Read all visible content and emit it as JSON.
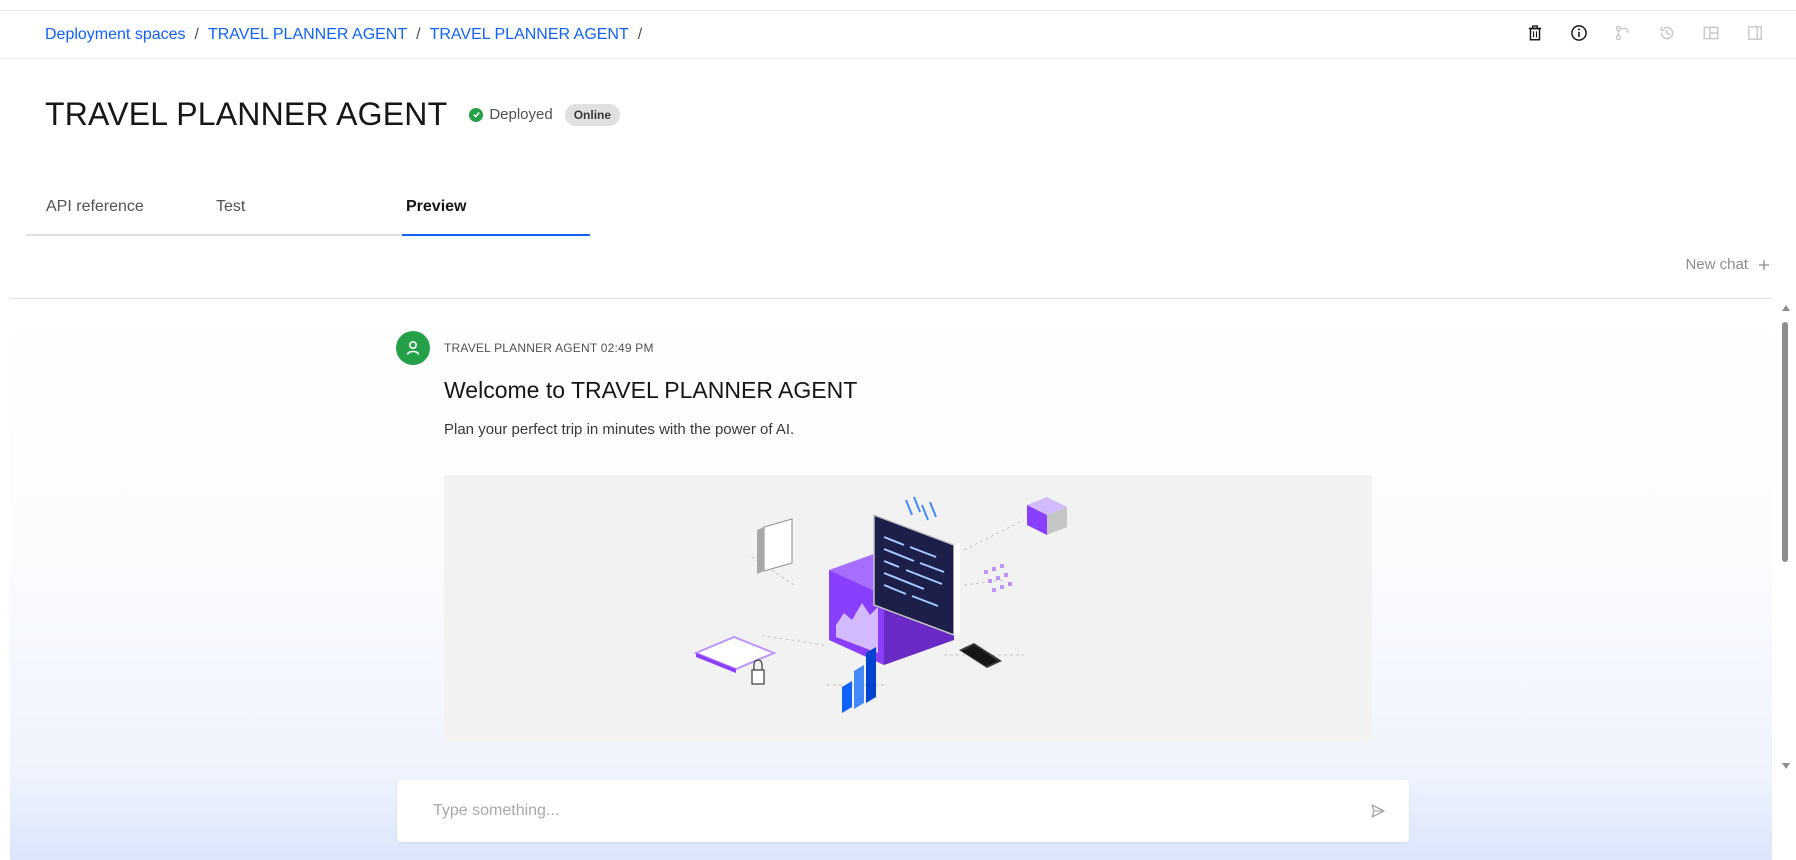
{
  "breadcrumb": {
    "items": [
      "Deployment spaces",
      "TRAVEL PLANNER AGENT",
      "TRAVEL PLANNER AGENT"
    ],
    "separator": "/"
  },
  "header": {
    "title": "TRAVEL PLANNER AGENT",
    "status_label": "Deployed",
    "badge": "Online",
    "actions": [
      "trash-icon",
      "info-icon",
      "share-icon",
      "history-icon",
      "layout-icon",
      "panel-icon"
    ]
  },
  "tabs": [
    {
      "label": "API reference",
      "active": false
    },
    {
      "label": "Test",
      "active": false
    },
    {
      "label": "Preview",
      "active": true
    }
  ],
  "chat": {
    "new_chat_label": "New chat",
    "new_chat_icon": "plus-icon",
    "message": {
      "sender_time": "TRAVEL PLANNER AGENT 02:49 PM",
      "title": "Welcome to TRAVEL PLANNER AGENT",
      "subtitle": "Plan your perfect trip in minutes with the power of AI."
    },
    "input_placeholder": "Type something...",
    "send_icon": "send-icon"
  },
  "colors": {
    "link": "#0f62fe",
    "status_green": "#24a148",
    "accent_purple": "#8a3ffc"
  }
}
